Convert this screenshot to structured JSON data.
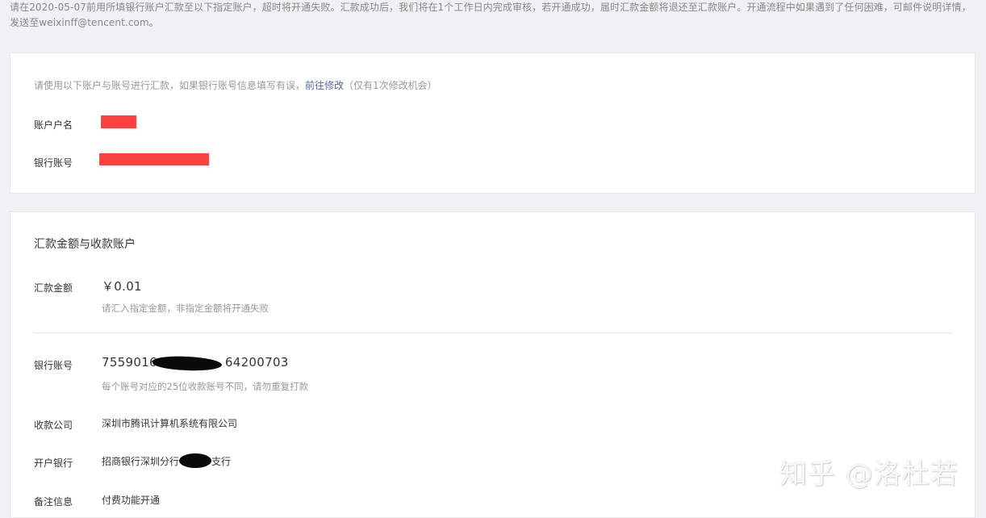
{
  "notice": "请在2020-05-07前用所填银行账户汇款至以下指定账户，超时将开通失败。汇款成功后，我们将在1个工作日内完成审核，若开通成功，届时汇款金额将退还至汇款账户。开通流程中如果遇到了任何困难，可邮件说明详情，发送至weixinff@tencent.com。",
  "sender": {
    "hint_prefix": "请使用以下账户与账号进行汇款，如果银行账号信息填写有误，",
    "hint_link": "前往修改",
    "hint_suffix": "（仅有1次修改机会）",
    "account_name_label": "账户户名",
    "bank_account_label": "银行账号"
  },
  "recipient": {
    "title": "汇款金额与收款账户",
    "amount_label": "汇款金额",
    "amount_value": "￥0.01",
    "amount_hint": "请汇入指定金额，非指定金额将开通失败",
    "bank_account_label": "银行账号",
    "bank_account_prefix": "7559016",
    "bank_account_suffix": "64200703",
    "bank_account_hint": "每个账号对应的25位收款账号不同，请勿重复打款",
    "company_label": "收款公司",
    "company_value": "深圳市腾讯计算机系统有限公司",
    "bank_label": "开户银行",
    "bank_value_prefix": "招商银行深圳分行",
    "bank_value_suffix": "支行",
    "remark_label": "备注信息",
    "remark_value": "付费功能开通"
  },
  "watermark": "知乎 @洛杜若",
  "colors": {
    "background": "#f0f1f3",
    "card": "#ffffff",
    "link": "#576b95",
    "redaction_red": "#ff4040",
    "redaction_black": "#0a0a0a"
  }
}
